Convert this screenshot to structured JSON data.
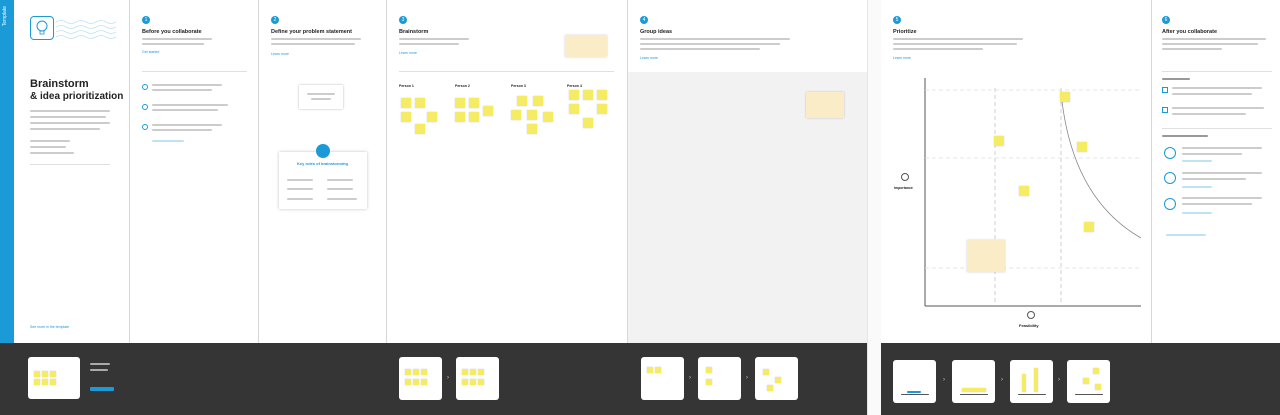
{
  "intro": {
    "strip_label": "Template",
    "title_line1": "Brainstorm",
    "title_line2": "& idea prioritization",
    "footer_link": "See more in the template"
  },
  "steps": [
    {
      "num": "1",
      "title": "Before you collaborate",
      "link": "Get started"
    },
    {
      "num": "2",
      "title": "Define your problem statement",
      "link": "Learn more"
    },
    {
      "num": "3",
      "title": "Brainstorm",
      "link": "Learn more"
    },
    {
      "num": "4",
      "title": "Group ideas",
      "link": "Learn more"
    },
    {
      "num": "5",
      "title": "Prioritize",
      "link": "Learn more"
    },
    {
      "num": "6",
      "title": "After you collaborate",
      "link": ""
    }
  ],
  "problem_card": {
    "title": "Key rules of brainstorming"
  },
  "brainstorm_groups": [
    "Person 1",
    "Person 2",
    "Person 3",
    "Person 4"
  ],
  "prioritize": {
    "x_label": "Feasibility",
    "y_label": "Importance"
  },
  "colors": {
    "accent": "#1a9ad6",
    "sticky": "#f5ec63",
    "dark": "#353535"
  }
}
